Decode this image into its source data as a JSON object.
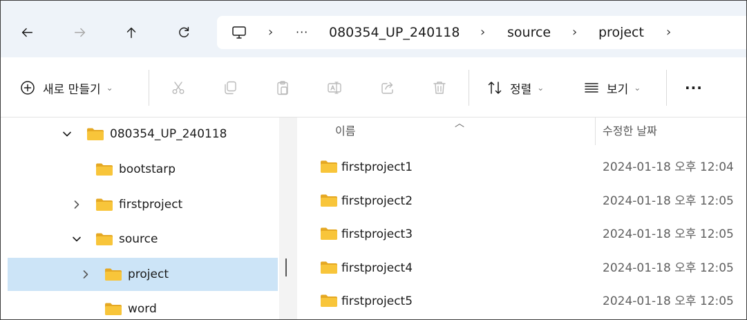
{
  "nav": {
    "breadcrumbs": [
      "080354_UP_240118",
      "source",
      "project"
    ],
    "more_crumbs": "···",
    "separator": "›"
  },
  "toolbar": {
    "new_label": "새로 만들기",
    "sort_label": "정렬",
    "view_label": "보기",
    "more_label": "···"
  },
  "tree": {
    "items": [
      {
        "label": "080354_UP_240118",
        "expander": "expanded"
      },
      {
        "label": "bootstarp",
        "expander": "none"
      },
      {
        "label": "firstproject",
        "expander": "collapsed"
      },
      {
        "label": "source",
        "expander": "expanded"
      },
      {
        "label": "project",
        "expander": "collapsed",
        "selected": true
      },
      {
        "label": "word",
        "expander": "none"
      }
    ]
  },
  "list": {
    "columns": {
      "name": "이름",
      "date": "수정한 날짜"
    },
    "rows": [
      {
        "name": "firstproject1",
        "date": "2024-01-18 오후 12:04"
      },
      {
        "name": "firstproject2",
        "date": "2024-01-18 오후 12:05"
      },
      {
        "name": "firstproject3",
        "date": "2024-01-18 오후 12:05"
      },
      {
        "name": "firstproject4",
        "date": "2024-01-18 오후 12:05"
      },
      {
        "name": "firstproject5",
        "date": "2024-01-18 오후 12:05"
      }
    ]
  },
  "colors": {
    "folder": "#f8c53a",
    "folder_dark": "#e5a823",
    "selection": "#cce4f7",
    "nav_bg": "#eef3f9"
  },
  "icons": [
    "back-arrow-icon",
    "forward-arrow-icon",
    "up-arrow-icon",
    "refresh-icon",
    "computer-icon",
    "plus-circle-icon",
    "cut-icon",
    "copy-icon",
    "paste-icon",
    "rename-icon",
    "share-icon",
    "delete-icon",
    "sort-icon",
    "view-icon",
    "more-icon",
    "folder-icon",
    "chevron-down-icon",
    "chevron-right-icon"
  ]
}
